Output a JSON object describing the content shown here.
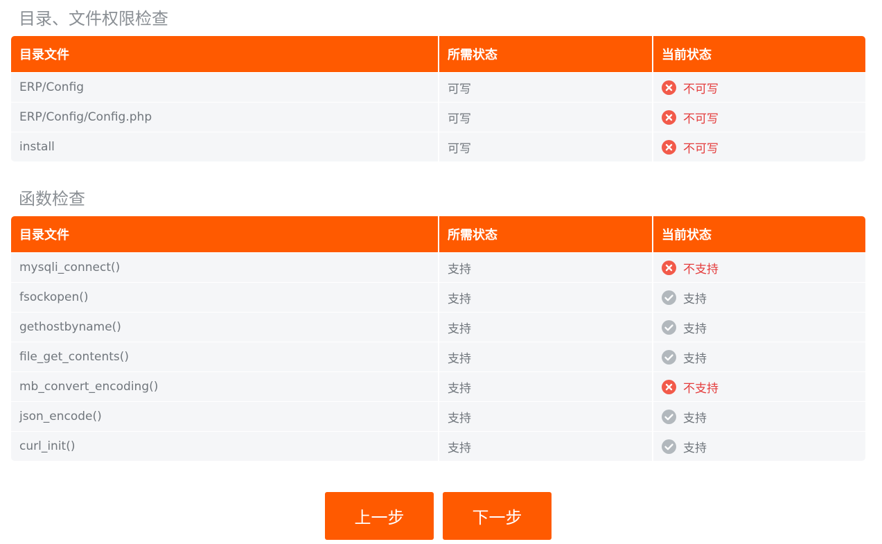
{
  "permissions": {
    "title": "目录、文件权限检查",
    "headers": [
      "目录文件",
      "所需状态",
      "当前状态"
    ],
    "rows": [
      {
        "name": "ERP/Config",
        "required": "可写",
        "current": "不可写",
        "ok": false
      },
      {
        "name": "ERP/Config/Config.php",
        "required": "可写",
        "current": "不可写",
        "ok": false
      },
      {
        "name": "install",
        "required": "可写",
        "current": "不可写",
        "ok": false
      }
    ]
  },
  "functions": {
    "title": "函数检查",
    "headers": [
      "目录文件",
      "所需状态",
      "当前状态"
    ],
    "rows": [
      {
        "name": "mysqli_connect()",
        "required": "支持",
        "current": "不支持",
        "ok": false
      },
      {
        "name": "fsockopen()",
        "required": "支持",
        "current": "支持",
        "ok": true
      },
      {
        "name": "gethostbyname()",
        "required": "支持",
        "current": "支持",
        "ok": true
      },
      {
        "name": "file_get_contents()",
        "required": "支持",
        "current": "支持",
        "ok": true
      },
      {
        "name": "mb_convert_encoding()",
        "required": "支持",
        "current": "不支持",
        "ok": false
      },
      {
        "name": "json_encode()",
        "required": "支持",
        "current": "支持",
        "ok": true
      },
      {
        "name": "curl_init()",
        "required": "支持",
        "current": "支持",
        "ok": true
      }
    ]
  },
  "buttons": {
    "prev_label": "上一步",
    "next_label": "下一步"
  },
  "colors": {
    "accent": "#ff5a00",
    "fail_icon": "#f25a4a",
    "fail_text": "#e43c3c",
    "ok_icon": "#b2b8bd"
  },
  "icons": {
    "fail": "close-circle-icon",
    "ok": "check-circle-icon"
  }
}
